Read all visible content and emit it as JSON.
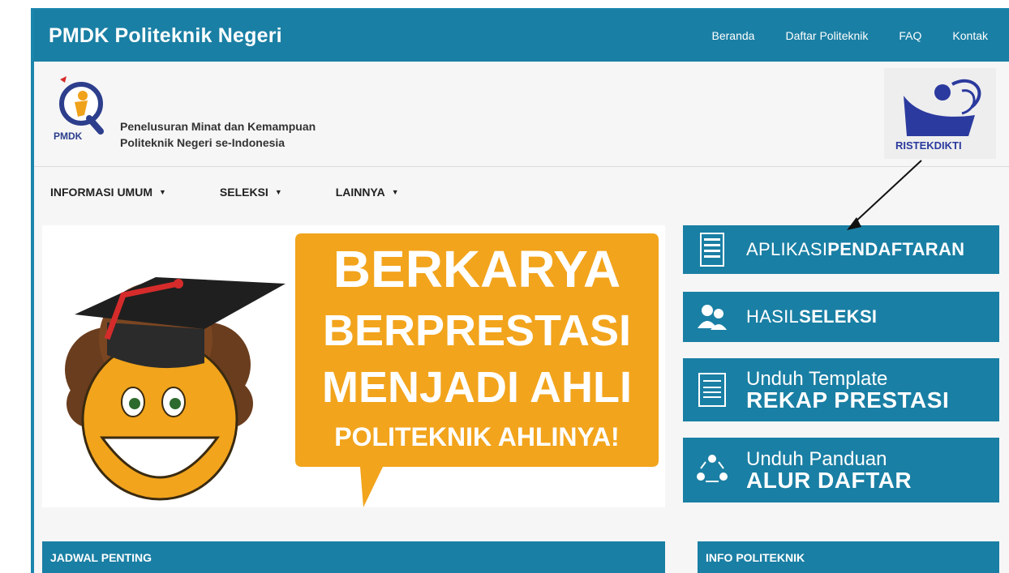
{
  "topbar": {
    "brand": "PMDK Politeknik Negeri",
    "nav": [
      "Beranda",
      "Daftar Politeknik",
      "FAQ",
      "Kontak"
    ]
  },
  "header": {
    "logo_text": "PMDK",
    "tagline_line1": "Penelusuran Minat dan Kemampuan",
    "tagline_line2": "Politeknik Negeri se-Indonesia",
    "partner_logo_text": "RISTEKDIKTI"
  },
  "menu": [
    {
      "label": "INFORMASI UMUM",
      "caret": "▼"
    },
    {
      "label": "SELEKSI",
      "caret": "▼"
    },
    {
      "label": "LAINNYA",
      "caret": "▼"
    }
  ],
  "banner": {
    "line1": "BERKARYA",
    "line2": "BERPRESTASI",
    "line3": "MENJADI AHLI",
    "line4": "POLITEKNIK AHLINYA!"
  },
  "side_buttons": {
    "aplikasi": {
      "light": "APLIKASI",
      "bold": "PENDAFTARAN"
    },
    "hasil": {
      "light": "HASIL",
      "bold": "SELEKSI"
    },
    "template": {
      "line1": "Unduh Template",
      "line2": "REKAP PRESTASI"
    },
    "panduan": {
      "line1": "Unduh Panduan",
      "line2": "ALUR DAFTAR"
    }
  },
  "sections": {
    "jadwal": "JADWAL PENTING",
    "info": "INFO POLITEKNIK"
  },
  "colors": {
    "primary": "#1a7fa4",
    "banner_orange": "#f2a41c",
    "background": "#f6f6f6"
  }
}
